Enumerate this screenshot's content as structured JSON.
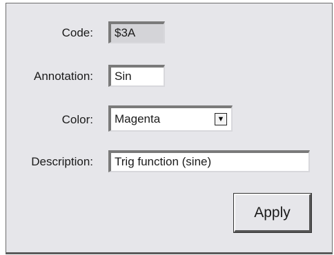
{
  "form": {
    "code": {
      "label": "Code:",
      "value": "$3A"
    },
    "annotation": {
      "label": "Annotation:",
      "value": "Sin"
    },
    "color": {
      "label": "Color:",
      "value": "Magenta",
      "arrow_icon": "triangle-down"
    },
    "description": {
      "label": "Description:",
      "value": "Trig function (sine)"
    },
    "apply_label": "Apply"
  }
}
